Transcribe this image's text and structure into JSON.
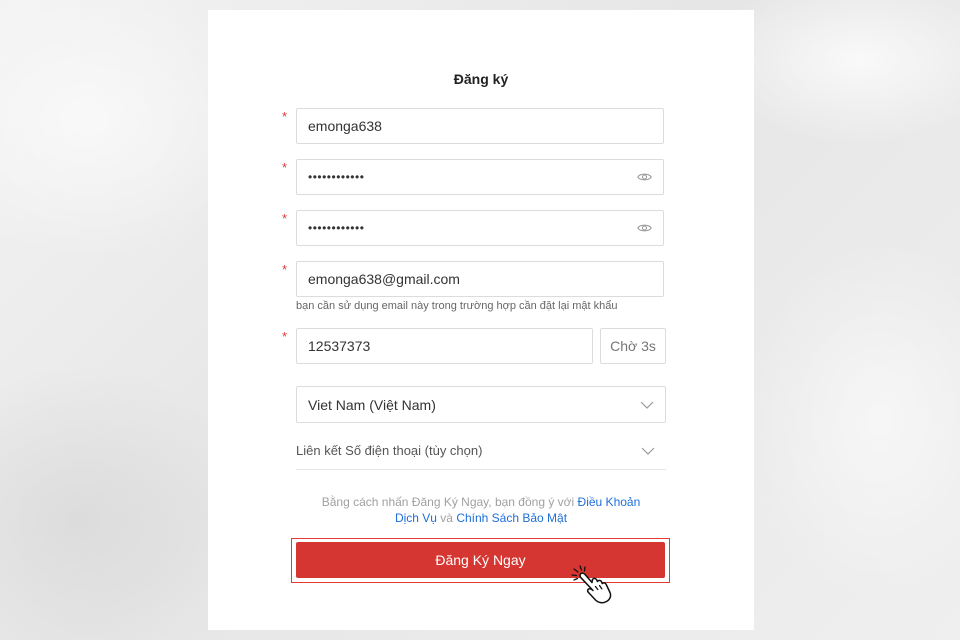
{
  "form": {
    "title": "Đăng ký",
    "required_mark": "*",
    "username_value": "emonga638",
    "password_value": "••••••••••••",
    "confirm_password_value": "••••••••••••",
    "email_value": "emonga638@gmail.com",
    "email_hint": "bạn cần sử dụng email này trong trường hợp cần đặt lại mật khẩu",
    "otp_value": "12537373",
    "otp_wait_label": "Chờ 3s",
    "country_value": "Viet Nam (Việt Nam)",
    "phone_link_label": "Liên kết Số điện thoại (tùy chọn)",
    "terms": {
      "prefix": "Bằng cách nhấn Đăng Ký Ngay, bạn đồng ý với ",
      "link1": "Điều Khoản Dịch Vụ",
      "middle": " và ",
      "link2": "Chính Sách Bảo Mật"
    },
    "submit_label": "Đăng Ký Ngay"
  },
  "colors": {
    "accent": "#d63631",
    "link": "#1e6fd9",
    "required": "#e53935"
  },
  "icons": {
    "password_toggle": "eye-icon",
    "dropdown": "chevron-down-icon",
    "cursor": "hand-pointer-icon"
  }
}
